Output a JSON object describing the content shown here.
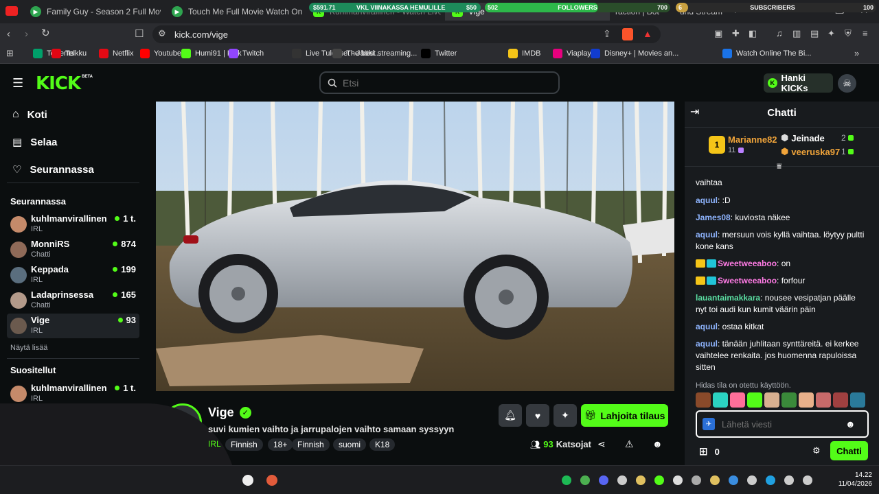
{
  "browser": {
    "tabs": [
      {
        "label": "Family Guy - Season 2 Full Movie Wa"
      },
      {
        "label": "Touch Me Full Movie Watch Online 1"
      },
      {
        "label": "Kuhlmanvirallinen - Watch Live on Kick"
      },
      {
        "label": "Vige"
      },
      {
        "label": "raction | Bot"
      },
      {
        "label": "und Stream"
      }
    ],
    "overlay": {
      "wallet_value": "$591.71",
      "goal_label": "VKL VIINAKASSA HEMULILLE",
      "goal_value": "$50",
      "followers_start": "502",
      "followers_label": "FOLLOWERS",
      "followers_end": "700",
      "subscribers_start": "6",
      "subscribers_label": "SUBSCRIBERS",
      "subscribers_end": "100",
      "followers_progress": 0.61,
      "subscribers_progress": 0.06
    },
    "url": "kick.com/vige",
    "bookmarks": [
      {
        "label": "Torrents",
        "icon": "torrents-icon",
        "color": "#00a06a"
      },
      {
        "label": "Telkku",
        "icon": "telkku-icon",
        "color": "#e30613"
      },
      {
        "label": "Netflix",
        "icon": "netflix-icon",
        "color": "#e50914"
      },
      {
        "label": "Youtube",
        "icon": "youtube-icon",
        "color": "#ff0000"
      },
      {
        "label": "Humi91 | Kick",
        "icon": "kick-icon",
        "color": "#53fc18"
      },
      {
        "label": "Twitch",
        "icon": "twitch-icon",
        "color": "#9146ff"
      },
      {
        "label": "Live Tulokset - Jääki...",
        "icon": "live-icon",
        "color": "#333333"
      },
      {
        "label": "The best streaming...",
        "icon": "streaming-icon",
        "color": "#444444"
      },
      {
        "label": "Twitter",
        "icon": "x-icon",
        "color": "#000000"
      },
      {
        "label": "IMDB",
        "icon": "imdb-icon",
        "color": "#f5c518"
      },
      {
        "label": "Viaplay",
        "icon": "viaplay-icon",
        "color": "#e6007e"
      },
      {
        "label": "Disney+ | Movies an...",
        "icon": "disney-icon",
        "color": "#113ccf"
      },
      {
        "label": "Watch Online The Bi...",
        "icon": "globe-icon",
        "color": "#1a73e8"
      }
    ]
  },
  "header": {
    "logo": "KICK",
    "logo_badge": "BETA",
    "search_placeholder": "Etsi",
    "get_kicks": "Hanki KICKs"
  },
  "sidebar": {
    "nav": [
      {
        "label": "Koti",
        "icon": "home-icon"
      },
      {
        "label": "Selaa",
        "icon": "browse-icon"
      },
      {
        "label": "Seurannassa",
        "icon": "heart-icon"
      }
    ],
    "following_title": "Seurannassa",
    "following": [
      {
        "name": "kuhlmanvirallinen",
        "category": "IRL",
        "viewers": "1 t.",
        "color": "#c58a6a"
      },
      {
        "name": "MonniRS",
        "category": "Chatti",
        "viewers": "874",
        "color": "#8f6a58"
      },
      {
        "name": "Keppada",
        "category": "IRL",
        "viewers": "199",
        "color": "#5a6e7e"
      },
      {
        "name": "Ladaprinsessa",
        "category": "Chatti",
        "viewers": "165",
        "color": "#b39a8a"
      },
      {
        "name": "Vige",
        "category": "IRL",
        "viewers": "93",
        "color": "#6b5a4e"
      }
    ],
    "show_more": "Näytä lisää",
    "recommended_title": "Suositellut",
    "recommended": [
      {
        "name": "kuhlmanvirallinen",
        "category": "IRL",
        "viewers": "1 t.",
        "color": "#c58a6a"
      }
    ]
  },
  "stream": {
    "channel": "Vige",
    "title": "suvi kumien vaihto ja jarrupalojen vaihto samaan syssyyn",
    "category": "IRL",
    "tags": [
      "Finnish",
      "18+",
      "Finnish",
      "suomi",
      "K18"
    ],
    "gift_sub": "Lahjoita tilaus",
    "viewers": "93",
    "viewers_label": "Katsojat"
  },
  "chat": {
    "title": "Chatti",
    "leaderboard": [
      {
        "rank": "1",
        "name": "Marianne82",
        "count": "11",
        "color": "#f5c518"
      },
      {
        "name": "Jeinade",
        "count": "2",
        "color": "#ffffff"
      },
      {
        "name": "veeruska97",
        "count": "1",
        "color": "#f0a43a"
      }
    ],
    "messages": [
      {
        "user": "",
        "text": "vaihtaa",
        "color": "#ffffff",
        "badges": false
      },
      {
        "user": "aquul",
        "text": ":D",
        "color": "#8fb5ff",
        "badges": false
      },
      {
        "user": "James08",
        "text": "kuviosta näkee",
        "color": "#8fb5ff",
        "badges": false
      },
      {
        "user": "aquul",
        "text": "mersuun vois kyllä vaihtaa. löytyy pultti kone kans",
        "color": "#8fb5ff",
        "badges": false
      },
      {
        "user": "Sweetweeaboo",
        "text": "on",
        "color": "#ff7be5",
        "badges": true
      },
      {
        "user": "Sweetweeaboo",
        "text": "forfour",
        "color": "#ff7be5",
        "badges": true
      },
      {
        "user": "lauantaimakkara",
        "text": "nousee vesipatjan päälle nyt toi audi kun kumit väärin päin",
        "color": "#5be0a3",
        "badges": false
      },
      {
        "user": "aquul",
        "text": "ostaa kitkat",
        "color": "#8fb5ff",
        "badges": false
      },
      {
        "user": "aquul",
        "text": "tänään juhlitaan synttäreitä. ei kerkee vaihtelee renkaita. jos huomenna rapuloissa sitten",
        "color": "#8fb5ff",
        "badges": false
      }
    ],
    "slow_mode": "Hidas tila on otettu käyttöön.",
    "input_placeholder": "Lähetä viesti",
    "kicks_count": "0",
    "send_label": "Chatti"
  },
  "taskbar": {
    "time": "14.22",
    "date": "11/04/2026"
  }
}
